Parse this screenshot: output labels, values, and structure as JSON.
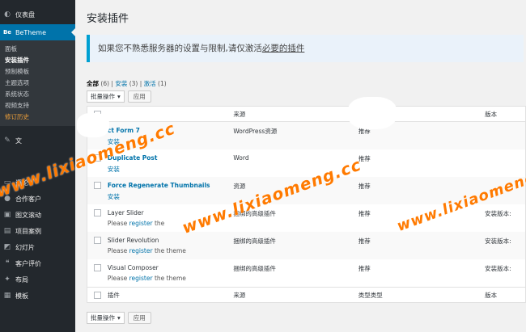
{
  "sidebar": {
    "dashboard": "仪表盘",
    "betheme": "BeTheme",
    "betheme_icon": "Be",
    "submenu": [
      {
        "label": "面板",
        "state": "normal"
      },
      {
        "label": "安装插件",
        "state": "active"
      },
      {
        "label": "预制模板",
        "state": "normal"
      },
      {
        "label": "主题选项",
        "state": "normal"
      },
      {
        "label": "系统状态",
        "state": "normal"
      },
      {
        "label": "视频支持",
        "state": "normal"
      },
      {
        "label": "修订历史",
        "state": "orange"
      }
    ],
    "items": [
      {
        "label": "文",
        "icon": "pin-icon"
      },
      {
        "label": "评论",
        "icon": "comment-icon"
      },
      {
        "label": "合作客户",
        "icon": "users-icon"
      },
      {
        "label": "图文滚动",
        "icon": "images-icon"
      },
      {
        "label": "项目案例",
        "icon": "portfolio-icon"
      },
      {
        "label": "幻灯片",
        "icon": "slides-icon"
      },
      {
        "label": "客户评价",
        "icon": "testimonial-icon"
      },
      {
        "label": "布局",
        "icon": "layout-icon"
      },
      {
        "label": "模板",
        "icon": "template-icon"
      }
    ]
  },
  "page": {
    "title": "安装插件",
    "notice_text": "如果您不熟悉服务器的设置与限制,请仅激活",
    "notice_link": "必要的插件"
  },
  "filters": {
    "all": "全部",
    "all_count": "(6)",
    "install": "安装",
    "install_count": "(3)",
    "activate": "激活",
    "activate_count": "(1)",
    "sep": "|"
  },
  "bulk": {
    "select": "批量操作",
    "apply": "应用"
  },
  "table": {
    "headers": {
      "source": "来源",
      "version": "版本"
    },
    "footers": {
      "name": "插件",
      "source": "来源",
      "type": "类型类型",
      "version": "版本"
    },
    "rows": [
      {
        "name": "Contact Form 7",
        "name_visible": "ct Form 7",
        "action": "安装",
        "source": "WordPress资源",
        "type": "推荐",
        "version": ""
      },
      {
        "name": "Duplicate Post",
        "action": "安装",
        "source": "Word",
        "type": "推荐",
        "version": ""
      },
      {
        "name": "Force Regenerate Thumbnails",
        "action": "安装",
        "source": "资源",
        "type": "推荐",
        "version": ""
      },
      {
        "name": "Layer Slider",
        "note_pre": "Please ",
        "note_link": "register",
        "note_post": " the",
        "source": "捆绑的高级插件",
        "type": "推荐",
        "version": "安装版本:"
      },
      {
        "name": "Slider Revolution",
        "note_pre": "Please ",
        "note_link": "register",
        "note_post": " the theme",
        "source": "捆绑的高级插件",
        "type": "推荐",
        "version": "安装版本:"
      },
      {
        "name": "Visual Composer",
        "note_pre": "Please ",
        "note_link": "register",
        "note_post": " the theme",
        "source": "捆绑的高级插件",
        "type": "推荐",
        "version": "安装版本:"
      }
    ]
  },
  "watermark": "www.lixiaomeng.cc"
}
